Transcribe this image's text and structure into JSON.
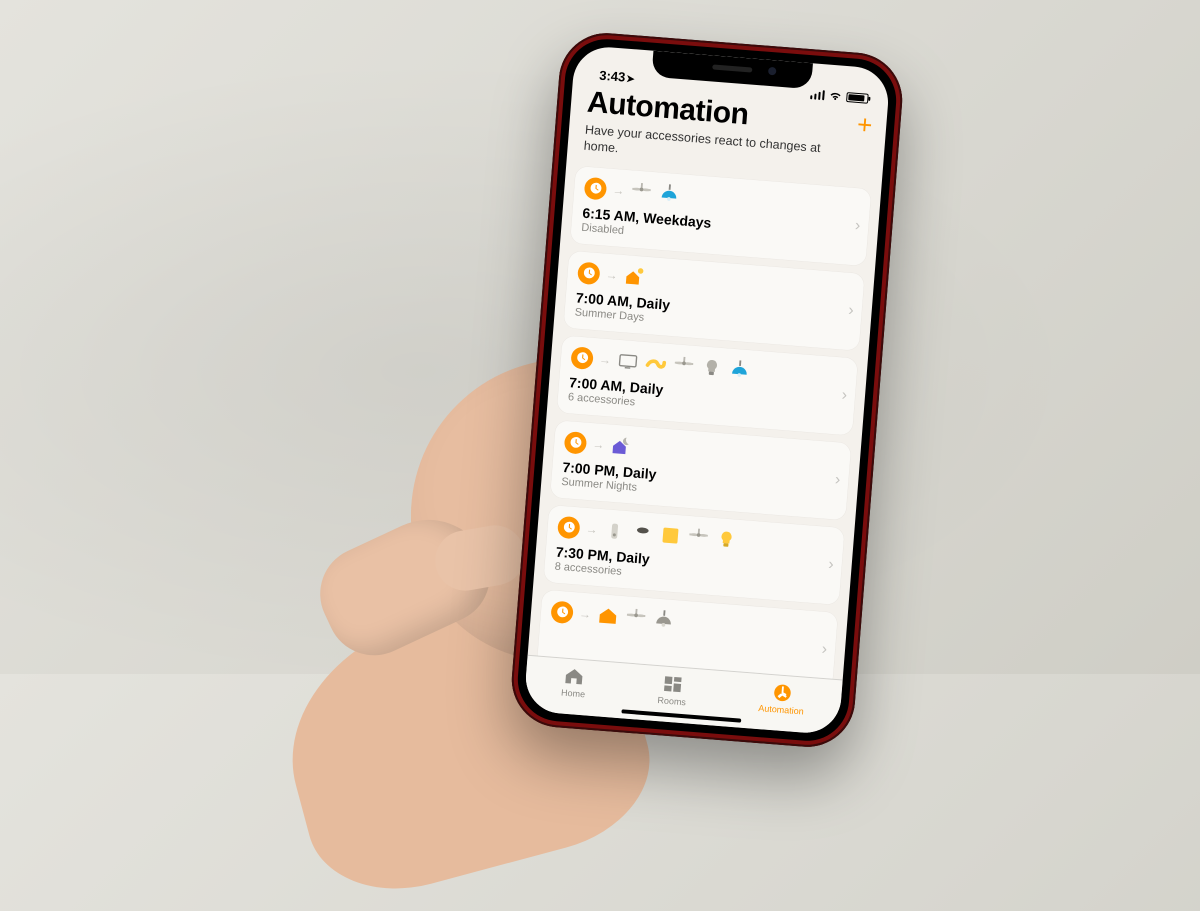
{
  "status": {
    "time": "3:43",
    "loc_indicator": "➤"
  },
  "header": {
    "title": "Automation",
    "subtitle": "Have your accessories react to changes at home.",
    "add_label": "+"
  },
  "automations": [
    {
      "title": "6:15 AM, Weekdays",
      "subtitle": "Disabled",
      "icons": [
        "fan",
        "pendant-blue"
      ]
    },
    {
      "title": "7:00 AM, Daily",
      "subtitle": "Summer Days",
      "icons": [
        "sunrise-house"
      ]
    },
    {
      "title": "7:00 AM, Daily",
      "subtitle": "6 accessories",
      "icons": [
        "tv",
        "strip",
        "fan",
        "bulb-grey",
        "pendant-blue"
      ]
    },
    {
      "title": "7:00 PM, Daily",
      "subtitle": "Summer Nights",
      "icons": [
        "nightfall-house"
      ]
    },
    {
      "title": "7:30 PM, Daily",
      "subtitle": "8 accessories",
      "icons": [
        "sensor",
        "puck",
        "panel",
        "fan",
        "bulb-yellow"
      ]
    },
    {
      "title": "",
      "subtitle": "",
      "icons": [
        "house-orange",
        "fan",
        "pendant-grey"
      ]
    }
  ],
  "tabs": [
    {
      "id": "home",
      "label": "Home",
      "active": false
    },
    {
      "id": "rooms",
      "label": "Rooms",
      "active": false
    },
    {
      "id": "automation",
      "label": "Automation",
      "active": true
    }
  ],
  "colors": {
    "accent": "#ff9500",
    "blue": "#1ea4d9",
    "purple": "#6b5bd6",
    "yellow": "#ffc93c"
  }
}
